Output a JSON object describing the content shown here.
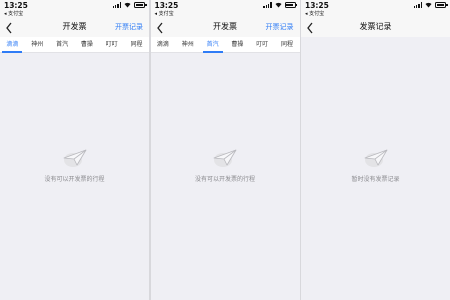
{
  "status_bar": {
    "time": "13:25",
    "back_app": "◂ 支付宝"
  },
  "screens": [
    {
      "title": "开发票",
      "action": "开票记录",
      "tabs": [
        "滴滴",
        "神州",
        "首汽",
        "曹操",
        "叮叮",
        "同程"
      ],
      "active_tab": 0,
      "empty_text": "没有可以开发票的行程"
    },
    {
      "title": "开发票",
      "action": "开票记录",
      "tabs": [
        "滴滴",
        "神州",
        "首汽",
        "曹操",
        "叮叮",
        "同程"
      ],
      "active_tab": 2,
      "empty_text": "没有可以开发票的行程"
    },
    {
      "title": "发票记录",
      "action": "",
      "tabs": [],
      "empty_text": "暂时没有发票记录"
    }
  ],
  "colors": {
    "accent": "#2f7cf6",
    "background": "#efeff4",
    "muted_text": "#8a8a8e"
  },
  "icons": {
    "back": "chevron-left-icon",
    "empty": "paper-plane-icon"
  }
}
